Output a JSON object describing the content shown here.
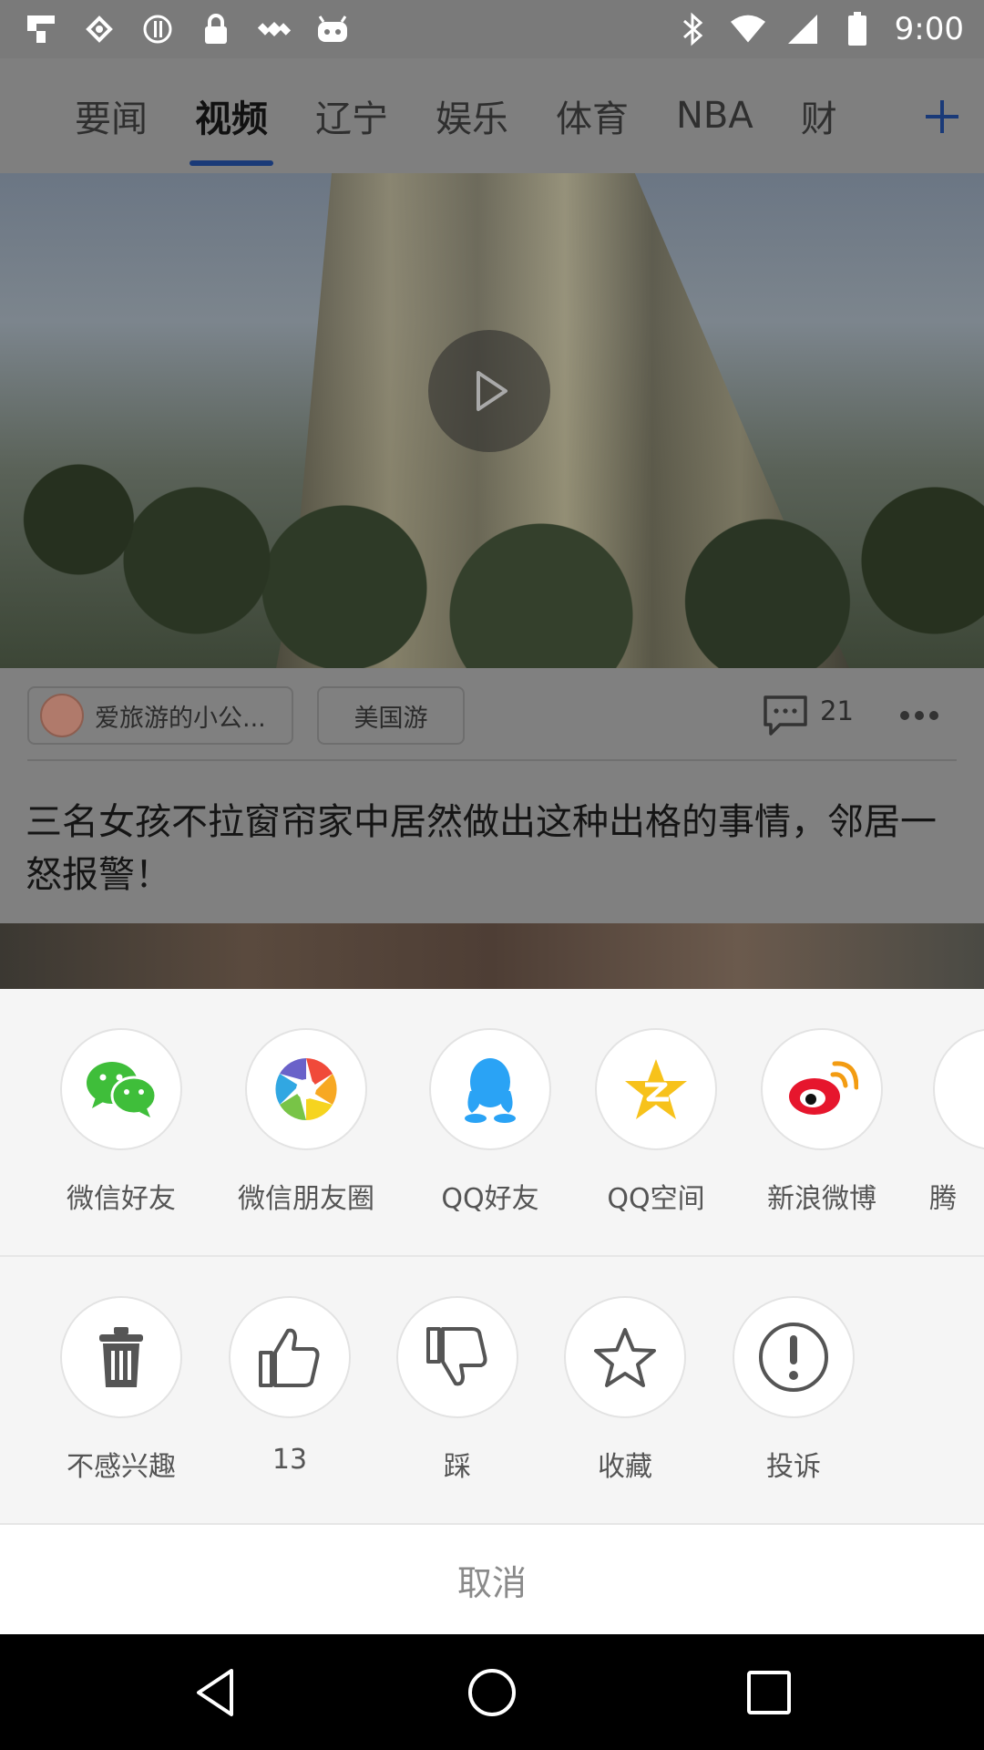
{
  "status_bar": {
    "time": "9:00",
    "left_icons": [
      "flipboard-icon",
      "android-toast-icon",
      "data-saver-icon",
      "lock-icon",
      "location-satellite-icon",
      "android-bot-icon"
    ],
    "right_icons": [
      "bluetooth-icon",
      "wifi-icon",
      "signal-icon",
      "battery-icon"
    ]
  },
  "top_nav": {
    "tabs": [
      {
        "label": "要闻",
        "active": false
      },
      {
        "label": "视频",
        "active": true
      },
      {
        "label": "辽宁",
        "active": false
      },
      {
        "label": "娱乐",
        "active": false
      },
      {
        "label": "体育",
        "active": false
      },
      {
        "label": "NBA",
        "active": false
      },
      {
        "label": "财",
        "active": false
      }
    ],
    "add_icon": "plus-icon",
    "accent_color": "#1a3a78"
  },
  "video_card": {
    "play_icon": "play-icon",
    "author": "爱旅游的小公...",
    "tag": "美国游",
    "comment_count": "21",
    "title": "三名女孩不拉窗帘家中居然做出这种出格的事情，邻居一怒报警！"
  },
  "share_sheet": {
    "share_targets": [
      {
        "label": "微信好友",
        "icon": "wechat-icon"
      },
      {
        "label": "微信朋友圈",
        "icon": "wechat-moments-icon"
      },
      {
        "label": "QQ好友",
        "icon": "qq-icon"
      },
      {
        "label": "QQ空间",
        "icon": "qzone-icon"
      },
      {
        "label": "新浪微博",
        "icon": "weibo-icon"
      },
      {
        "label": "腾",
        "icon": "tencent-icon"
      }
    ],
    "actions": [
      {
        "label": "不感兴趣",
        "icon": "trash-icon"
      },
      {
        "label": "13",
        "icon": "thumbs-up-icon"
      },
      {
        "label": "踩",
        "icon": "thumbs-down-icon"
      },
      {
        "label": "收藏",
        "icon": "star-icon"
      },
      {
        "label": "投诉",
        "icon": "report-icon"
      }
    ],
    "cancel_label": "取消"
  },
  "nav_bar": {
    "icons": [
      "back-icon",
      "home-icon",
      "recents-icon"
    ]
  }
}
